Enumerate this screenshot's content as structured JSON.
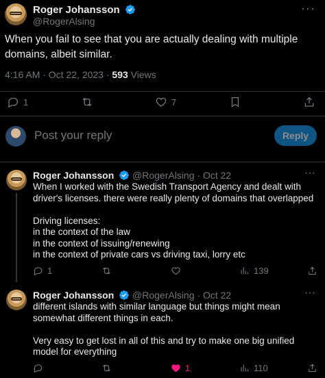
{
  "main_tweet": {
    "author_name": "Roger Johansson",
    "author_handle": "@RogerAlsing",
    "text": "When you fail to see that you are actually dealing with multiple domains, albeit similar.",
    "time": "4:16 AM · Oct 22, 2023 · ",
    "views_count": "593",
    "views_label": " Views",
    "replies": "1",
    "retweets": "",
    "likes": "7"
  },
  "composer": {
    "placeholder": "Post your reply",
    "button_label": "Reply"
  },
  "replies": [
    {
      "author_name": "Roger Johansson",
      "author_handle": "@RogerAlsing · Oct 22",
      "text": "When I worked with the Swedish Transport Agency and dealt with driver's licenses. there were really plenty of domains that overlapped\n\nDriving licenses:\nin the context of the law\nin the context of issuing/renewing\nin the context of private cars vs driving taxi, lorry etc",
      "replies": "1",
      "retweets": "",
      "likes": "",
      "views": "139"
    },
    {
      "author_name": "Roger Johansson",
      "author_handle": "@RogerAlsing · Oct 22",
      "text": "different islands with similar language but things might mean somewhat different things in each.\n\nVery easy to get lost in all of this and try to make one big unified model for everything",
      "replies": "",
      "retweets": "",
      "likes": "1",
      "views": "110"
    }
  ],
  "colors": {
    "accent": "#1d9bf0",
    "like": "#f91880",
    "muted": "#71767b",
    "border": "#2f3336"
  }
}
